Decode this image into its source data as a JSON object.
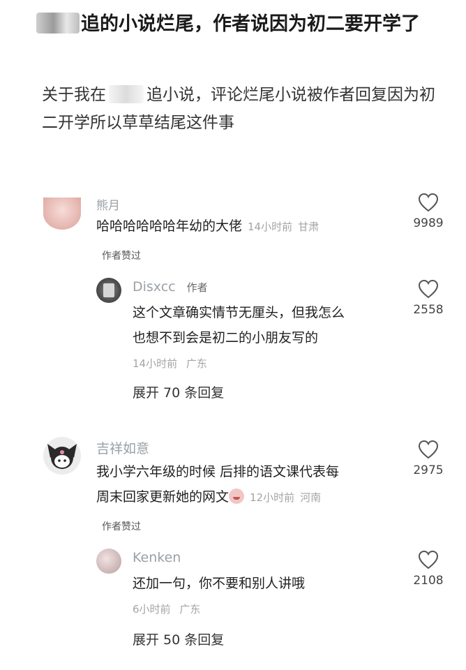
{
  "post": {
    "title_rest": "追的小说烂尾，作者说因为初二要开学了",
    "sub_prefix": "关于我在",
    "sub_rest": "追小说，评论烂尾小说被作者回复因为初二开学所以草草结尾这件事"
  },
  "comments": [
    {
      "username": "熊月",
      "text": "哈哈哈哈哈哈年幼的大佬",
      "time": "14小时前",
      "location": "甘肃",
      "likes": "9989",
      "author_liked": "作者赞过",
      "reply": {
        "username": "Disxcc",
        "author_tag": "作者",
        "text_line1": "这个文章确实情节无厘头，但我怎么",
        "text_line2": "也想不到会是初二的小朋友写的",
        "time": "14小时前",
        "location": "广东",
        "likes": "2558"
      },
      "expand_label": "展开 70 条回复"
    },
    {
      "username": "吉祥如意",
      "text_line1": "我小学六年级的时候 后排的语文课代表每",
      "text_line2": "周末回家更新她的网文",
      "time": "12小时前",
      "location": "河南",
      "likes": "2975",
      "author_liked": "作者赞过",
      "reply": {
        "username": "Kenken",
        "text": "还加一句，你不要和别人讲哦",
        "time": "6小时前",
        "location": "广东",
        "likes": "2108"
      },
      "expand_label": "展开 50 条回复"
    }
  ],
  "icons": {
    "like": "heart-outline-icon"
  },
  "colors": {
    "muted": "#9aa0a6",
    "text": "#1f1f1f",
    "bg": "#ffffff"
  }
}
